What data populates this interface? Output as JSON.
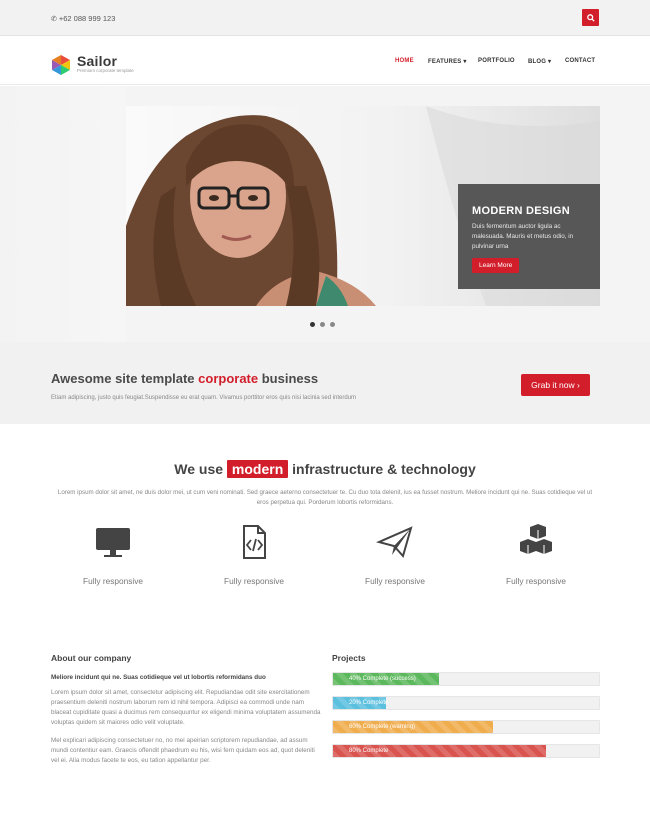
{
  "topbar": {
    "phone": "+62 088 999 123"
  },
  "brand": {
    "name": "Sailor",
    "tagline": "Premium corporate template"
  },
  "nav": {
    "items": [
      {
        "label": "HOME",
        "active": true
      },
      {
        "label": "FEATURES ▾",
        "active": false
      },
      {
        "label": "PORTFOLIO",
        "active": false
      },
      {
        "label": "BLOG ▾",
        "active": false
      },
      {
        "label": "CONTACT",
        "active": false
      }
    ]
  },
  "hero": {
    "caption_title": "MODERN DESIGN",
    "caption_text": "Duis fermentum auctor ligula ac malesuada. Mauris et metus odio, in pulvinar urna",
    "button": "Learn More"
  },
  "cta": {
    "title_start": "Awesome site template ",
    "title_highlight": "corporate",
    "title_end": " business",
    "subtitle": "Etiam adipiscing, justo quis feugiat.Suspendisse eu erat quam. Vivamus porttitor eros quis nisi lacinia sed interdum",
    "button": "Grab it now ›"
  },
  "features": {
    "title_start": "We use ",
    "title_highlight": "modern",
    "title_end": " infrastructure & technology",
    "description": "Lorem ipsum dolor sit amet, ne duis dolor mei, ut cum veni nominati. Sed graece aeterno consectetuer te. Cu duo tota delenit, ius ea fusset nostrum. Meliore incidunt qui ne. Suas cotidieque vel ut eros perpetua qui. Porderum lobortis reformidans.",
    "items": [
      {
        "icon": "monitor-icon",
        "label": "Fully responsive"
      },
      {
        "icon": "code-file-icon",
        "label": "Fully responsive"
      },
      {
        "icon": "paper-plane-icon",
        "label": "Fully responsive"
      },
      {
        "icon": "cubes-icon",
        "label": "Fully responsive"
      }
    ]
  },
  "about": {
    "title": "About our company",
    "lead": "Meliore incidunt qui ne. Suas cotidieque vel ut lobortis reformidans duo",
    "p1": "Lorem ipsum dolor sit amet, consectetur adipiscing elit. Repudiandae odit site exercitationem praesentium deleniti nostrum laborum rem id nihil tempora. Adipisci ea commodi unde nam blaceat cupiditate quasi a ducimus rem consequuntur ex eligendi minima voluptatem assumenda voluptas quidem sit maiores odio velit voluptate.",
    "p2": "Mel explicari adipiscing consectetuer no, no mei apeirian scriptorem repudiandae, ad assum mundi contentiur eam. Graecis offendit phaedrum eu his, wisi fern quidam eos ad, quot deleniti vel ei. Alia modus facete te eos, eu tation appellantur per."
  },
  "projects": {
    "title": "Projects",
    "bars": [
      {
        "label": "40% Complete (success)",
        "percent": 40,
        "color": "#5cb85c"
      },
      {
        "label": "20% Complete",
        "percent": 20,
        "color": "#5bc0de"
      },
      {
        "label": "60% Complete (warning)",
        "percent": 60,
        "color": "#f0ad4e"
      },
      {
        "label": "80% Complete",
        "percent": 80,
        "color": "#d9534f"
      }
    ]
  },
  "colors": {
    "accent": "#d21e2b"
  }
}
